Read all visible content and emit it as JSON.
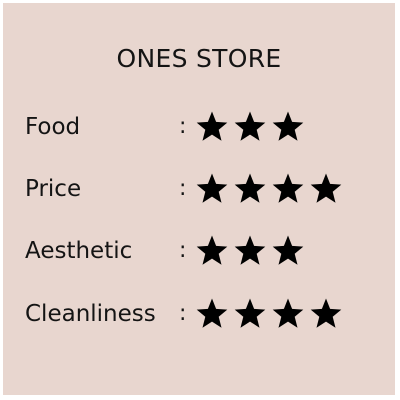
{
  "store": {
    "title": "ONES STORE"
  },
  "ratings": [
    {
      "label": "Food",
      "separator": ":",
      "stars": 3
    },
    {
      "label": "Price",
      "separator": ":",
      "stars": 4
    },
    {
      "label": "Aesthetic",
      "separator": ":",
      "stars": 3
    },
    {
      "label": "Cleanliness",
      "separator": ":",
      "stars": 4
    }
  ],
  "icons": {
    "rating": "star-icon"
  },
  "colors": {
    "card_background": "#e8d6cf",
    "text": "#141414",
    "star": "#000000"
  }
}
